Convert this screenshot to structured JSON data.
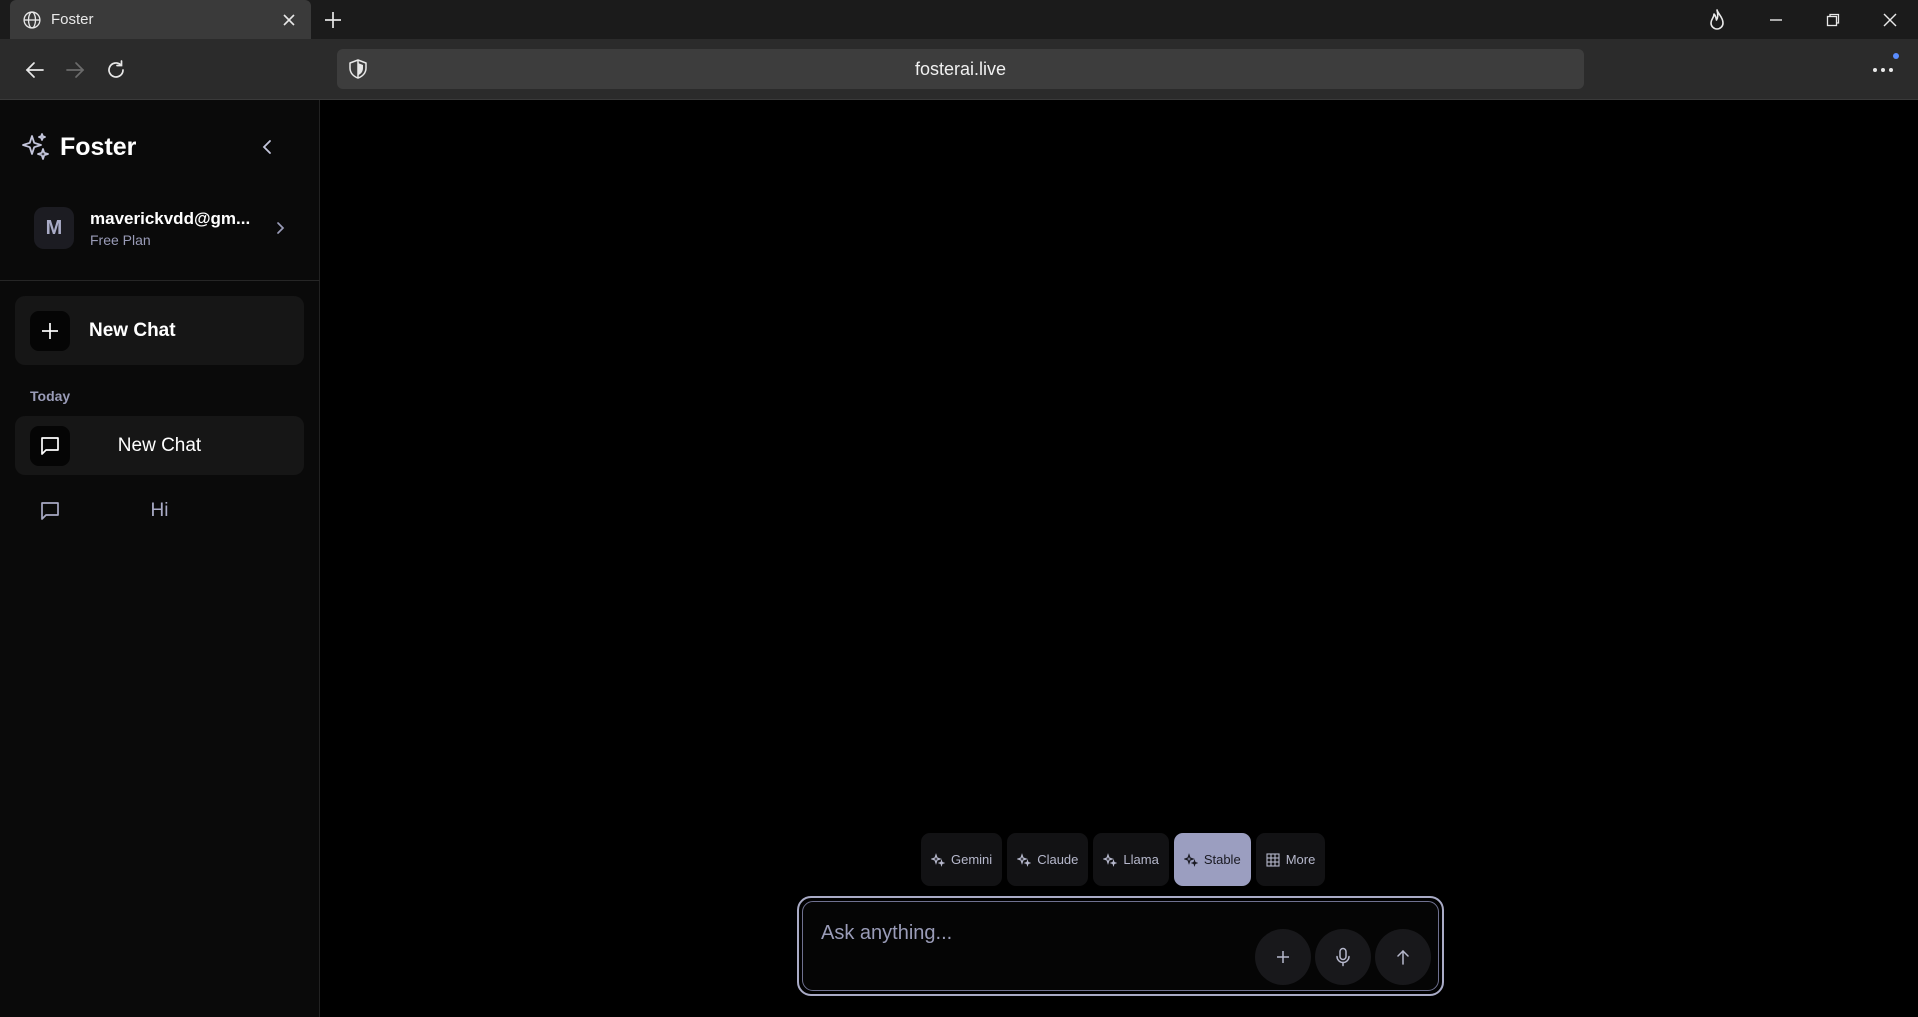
{
  "browser": {
    "tab_title": "Foster",
    "url": "fosterai.live"
  },
  "sidebar": {
    "brand": "Foster",
    "account": {
      "avatar_initial": "M",
      "email": "maverickvdd@gm...",
      "plan": "Free Plan"
    },
    "new_chat_label": "New Chat",
    "section_today": "Today",
    "chats": [
      {
        "label": "New Chat",
        "active": true
      },
      {
        "label": "Hi",
        "active": false
      }
    ]
  },
  "main": {
    "models": [
      {
        "label": "Gemini",
        "icon": "sparkles-icon"
      },
      {
        "label": "Claude",
        "icon": "sparkles-icon"
      },
      {
        "label": "Llama",
        "icon": "sparkles-icon"
      },
      {
        "label": "Stable",
        "icon": "sparkles-icon",
        "active": true
      },
      {
        "label": "More",
        "icon": "grid-icon"
      }
    ],
    "composer": {
      "placeholder": "Ask anything...",
      "value": ""
    }
  },
  "colors": {
    "background": "#000000",
    "sidebar": "#0a0a0a",
    "accent": "#9b9ec0",
    "muted_text": "#9a9cb8"
  }
}
